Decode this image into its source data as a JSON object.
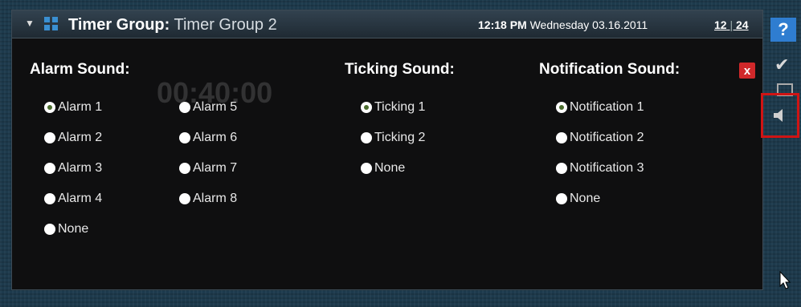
{
  "titlebar": {
    "title_bold": "Timer Group:",
    "title_name": "Timer Group 2",
    "time": "12:18 PM",
    "date": "Wednesday 03.16.2011",
    "format_12": "12",
    "format_24": "24"
  },
  "alarm": {
    "heading": "Alarm Sound:",
    "options": [
      "Alarm 1",
      "Alarm 2",
      "Alarm 3",
      "Alarm 4",
      "None",
      "Alarm 5",
      "Alarm 6",
      "Alarm 7",
      "Alarm 8"
    ],
    "selected": "Alarm 1"
  },
  "ticking": {
    "heading": "Ticking Sound:",
    "options": [
      "Ticking 1",
      "Ticking 2",
      "None"
    ],
    "selected": "Ticking 1"
  },
  "notification": {
    "heading": "Notification Sound:",
    "options": [
      "Notification 1",
      "Notification 2",
      "Notification 3",
      "None"
    ],
    "selected": "Notification 1"
  },
  "close_label": "x",
  "sidebar": {
    "help_label": "?"
  },
  "colors": {
    "accent": "#2f7dd0",
    "close": "#d0282a",
    "highlight": "#d01414",
    "selected_dot": "#4b6d2e"
  }
}
